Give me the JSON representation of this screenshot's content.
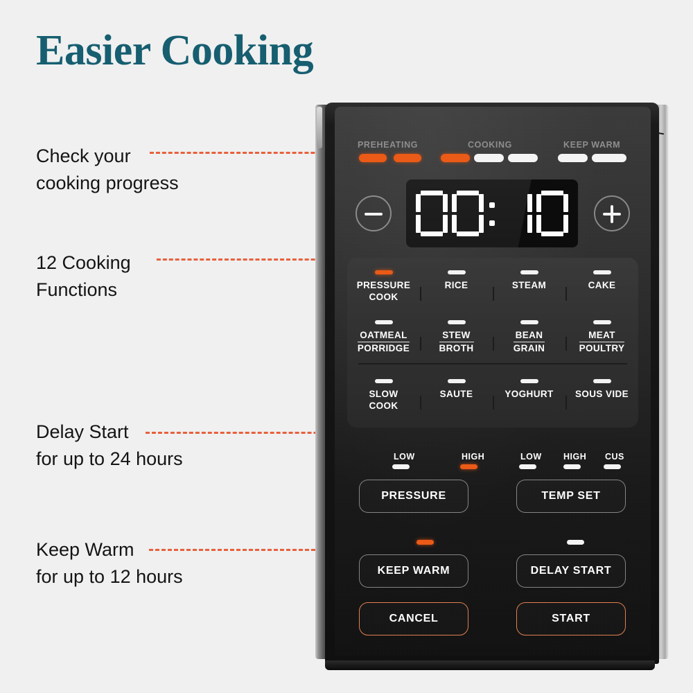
{
  "title": "Easier Cooking",
  "annotations": [
    {
      "line1": "Check your",
      "line2": "cooking progress"
    },
    {
      "line1": "12 Cooking",
      "line2": "Functions"
    },
    {
      "line1": "Delay Start",
      "line2": "for up to 24 hours"
    },
    {
      "line1": "Keep Warm",
      "line2": "for up to 12 hours"
    }
  ],
  "device": {
    "progress": {
      "labels": [
        "PREHEATING",
        "COOKING",
        "KEEP WARM"
      ],
      "segments": [
        {
          "state": "on"
        },
        {
          "state": "on"
        },
        {
          "state": "on"
        },
        {
          "state": "off"
        },
        {
          "state": "off"
        },
        {
          "state": "off"
        },
        {
          "state": "off"
        }
      ]
    },
    "display": {
      "value": "00:10",
      "hours": "00",
      "minutes": "10",
      "separator": ":"
    },
    "stepper": {
      "decrease": "minus-icon",
      "increase": "plus-icon"
    },
    "functions": [
      {
        "label_line1": "PRESSURE",
        "label_line2": "COOK",
        "underline": false,
        "led": "on"
      },
      {
        "label_line1": "RICE",
        "label_line2": "",
        "underline": false,
        "led": "off"
      },
      {
        "label_line1": "STEAM",
        "label_line2": "",
        "underline": false,
        "led": "off"
      },
      {
        "label_line1": "CAKE",
        "label_line2": "",
        "underline": false,
        "led": "off"
      },
      {
        "label_line1": "OATMEAL",
        "label_line2": "PORRIDGE",
        "underline": true,
        "led": "off"
      },
      {
        "label_line1": "STEW",
        "label_line2": "BROTH",
        "underline": true,
        "led": "off"
      },
      {
        "label_line1": "BEAN",
        "label_line2": "GRAIN",
        "underline": true,
        "led": "off"
      },
      {
        "label_line1": "MEAT",
        "label_line2": "POULTRY",
        "underline": true,
        "led": "off"
      },
      {
        "label_line1": "SLOW",
        "label_line2": "COOK",
        "underline": false,
        "led": "off"
      },
      {
        "label_line1": "SAUTE",
        "label_line2": "",
        "underline": false,
        "led": "off"
      },
      {
        "label_line1": "YOGHURT",
        "label_line2": "",
        "underline": false,
        "led": "off"
      },
      {
        "label_line1": "SOUS VIDE",
        "label_line2": "",
        "underline": false,
        "led": "off"
      }
    ],
    "pressure": {
      "button": "PRESSURE",
      "modes": [
        {
          "label": "LOW",
          "led": "off"
        },
        {
          "label": "HIGH",
          "led": "on"
        }
      ]
    },
    "temp_set": {
      "button": "TEMP SET",
      "modes": [
        {
          "label": "LOW",
          "led": "off"
        },
        {
          "label": "HIGH",
          "led": "off"
        },
        {
          "label": "CUS",
          "led": "off"
        }
      ]
    },
    "keep_warm": {
      "button": "KEEP WARM",
      "led": "on"
    },
    "delay_start": {
      "button": "DELAY START",
      "led": "off"
    },
    "cancel": "CANCEL",
    "start": "START"
  },
  "colors": {
    "title": "#165e70",
    "accent": "#f0552a",
    "led_on": "#eb5a16",
    "led_off": "#f4f4f4",
    "background": "#f0f0f0"
  }
}
